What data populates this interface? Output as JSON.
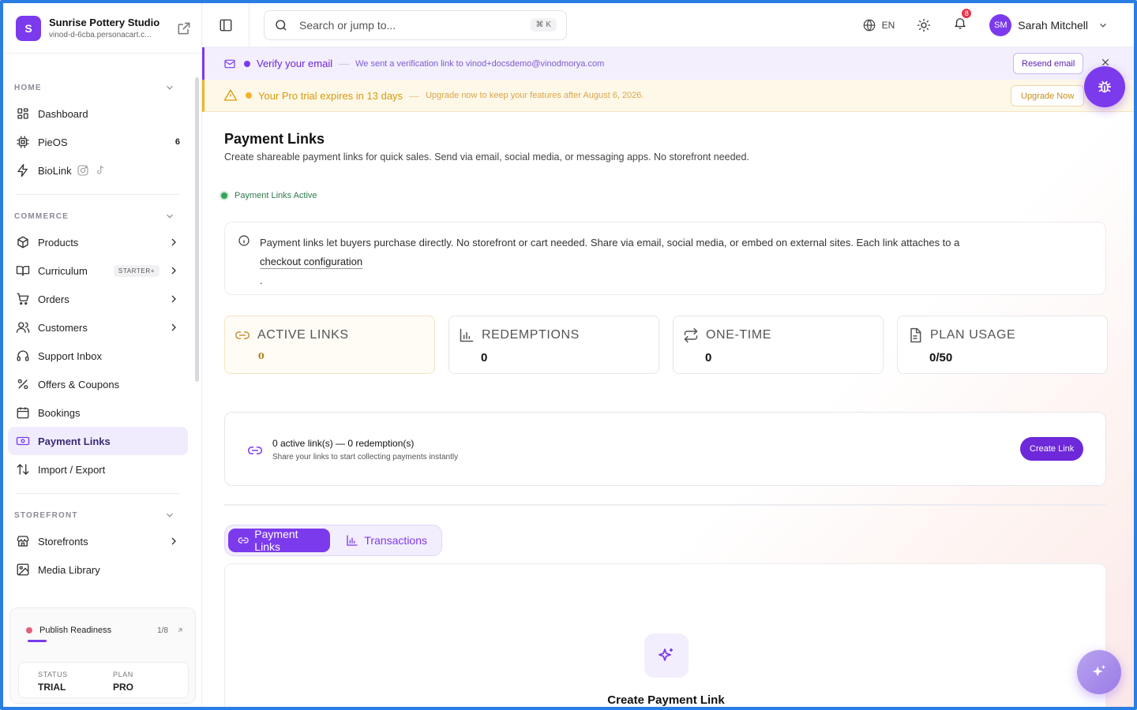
{
  "brand": {
    "initial": "S",
    "name": "Sunrise Pottery Studio",
    "url": "vinod-d-6cba.personacart.c..."
  },
  "sidebar": {
    "sections": [
      {
        "title": "HOME",
        "items": [
          {
            "label": "Dashboard",
            "icon": "dashboard-icon"
          },
          {
            "label": "PieOS",
            "icon": "cpu-icon",
            "count": "6"
          },
          {
            "label": "BioLink",
            "icon": "bolt-icon"
          }
        ]
      },
      {
        "title": "COMMERCE",
        "items": [
          {
            "label": "Products",
            "icon": "box-icon"
          },
          {
            "label": "Curriculum",
            "icon": "book-icon",
            "badge": "STARTER+"
          },
          {
            "label": "Orders",
            "icon": "cart-icon"
          },
          {
            "label": "Customers",
            "icon": "users-icon"
          },
          {
            "label": "Support Inbox",
            "icon": "headset-icon"
          },
          {
            "label": "Offers & Coupons",
            "icon": "percent-icon"
          },
          {
            "label": "Bookings",
            "icon": "calendar-icon"
          },
          {
            "label": "Payment Links",
            "icon": "banknote-icon",
            "active": true
          },
          {
            "label": "Import / Export",
            "icon": "arrows-updown-icon"
          }
        ]
      },
      {
        "title": "STOREFRONT",
        "items": [
          {
            "label": "Storefronts",
            "icon": "store-icon"
          },
          {
            "label": "Media Library",
            "icon": "image-icon"
          }
        ]
      }
    ],
    "publish": {
      "label": "Publish Readiness",
      "count": "1/8",
      "progress": 0.125
    },
    "status": {
      "status_key": "STATUS",
      "status_value": "TRIAL",
      "plan_key": "PLAN",
      "plan_value": "PRO"
    }
  },
  "topbar": {
    "search_placeholder": "Search or jump to...",
    "search_shortcut": "⌘ K",
    "language": "EN",
    "notifications_count": "8",
    "user_initials": "SM",
    "user_name": "Sarah Mitchell"
  },
  "banners": {
    "verify": {
      "title": "Verify your email",
      "separator": "—",
      "text": "We sent a verification link to vinod+docsdemo@vinodmorya.com",
      "button": "Resend email"
    },
    "trial": {
      "title": "Your Pro trial expires in 13 days",
      "separator": "—",
      "text": "Upgrade now to keep your features after August 6, 2026.",
      "button": "Upgrade Now"
    }
  },
  "page": {
    "title": "Payment Links",
    "subtitle": "Create shareable payment links for quick sales. Send via email, social media, or messaging apps. No storefront needed.",
    "status": "Payment Links Active",
    "info_text": "Payment links let buyers purchase directly. No storefront or cart needed. Share via email, social media, or embed on external sites. Each link attaches to a",
    "info_link": "checkout configuration",
    "info_tail": ".",
    "stats": [
      {
        "label": "ACTIVE LINKS",
        "value": "0",
        "icon": "link-icon"
      },
      {
        "label": "REDEMPTIONS",
        "value": "0",
        "icon": "bar-chart-icon"
      },
      {
        "label": "ONE-TIME",
        "value": "0",
        "icon": "repeat-icon"
      },
      {
        "label": "PLAN USAGE",
        "value": "0/50",
        "icon": "document-icon"
      }
    ],
    "summary_title": "0 active link(s) — 0 redemption(s)",
    "summary_sub": "Share your links to start collecting payments instantly",
    "create_button": "Create Link",
    "tabs": [
      {
        "label": "Payment Links",
        "active": true
      },
      {
        "label": "Transactions",
        "active": false
      }
    ],
    "empty_title": "Create Payment Link"
  },
  "colors": {
    "accent": "#7c3aed",
    "trial": "#d99a0a",
    "active_status": "#34a35b"
  }
}
